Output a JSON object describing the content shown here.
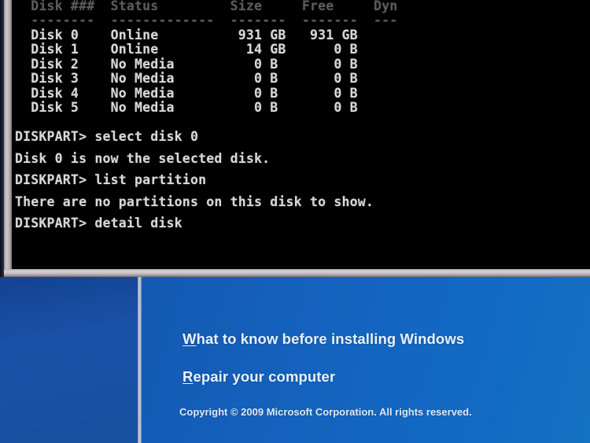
{
  "console": {
    "table": {
      "headers": [
        "Disk ###",
        "Status",
        "Size",
        "Free",
        "Dyn"
      ],
      "header_line": "  Disk ###  Status         Size     Free     Dyn",
      "separator_line": "  --------  -------------  -------  -------  ---",
      "rows": [
        {
          "disk": "Disk 0",
          "status": "Online",
          "size": "931 GB",
          "free": "931 GB"
        },
        {
          "disk": "Disk 1",
          "status": "Online",
          "size": "14 GB",
          "free": "0 B"
        },
        {
          "disk": "Disk 2",
          "status": "No Media",
          "size": "0 B",
          "free": "0 B"
        },
        {
          "disk": "Disk 3",
          "status": "No Media",
          "size": "0 B",
          "free": "0 B"
        },
        {
          "disk": "Disk 4",
          "status": "No Media",
          "size": "0 B",
          "free": "0 B"
        },
        {
          "disk": "Disk 5",
          "status": "No Media",
          "size": "0 B",
          "free": "0 B"
        }
      ],
      "rendered_rows": [
        "  Disk 0    Online          931 GB   931 GB",
        "  Disk 1    Online           14 GB      0 B",
        "  Disk 2    No Media          0 B       0 B",
        "  Disk 3    No Media          0 B       0 B",
        "  Disk 4    No Media          0 B       0 B",
        "  Disk 5    No Media          0 B       0 B"
      ]
    },
    "prompt": "DISKPART>",
    "transcript": [
      "DISKPART> select disk 0",
      "Disk 0 is now the selected disk.",
      "DISKPART> list partition",
      "There are no partitions on this disk to show.",
      "DISKPART> detail disk"
    ],
    "commands": [
      "select disk 0",
      "list partition",
      "detail disk"
    ],
    "messages": [
      "Disk 0 is now the selected disk.",
      "There are no partitions on this disk to show."
    ],
    "colors": {
      "background": "#000000",
      "text": "#d8d8d8",
      "frame": "#cdc9cc"
    }
  },
  "setup": {
    "links": [
      {
        "accel": "W",
        "rest": "hat to know before installing Windows"
      },
      {
        "accel": "R",
        "rest": "epair your computer"
      }
    ],
    "copyright": "Copyright © 2009 Microsoft Corporation. All rights reserved.",
    "colors": {
      "left_pane": "#1a52a8",
      "right_pane": "#1463be",
      "divider": "#c3ccdb",
      "link_text": "#eaf1fb"
    }
  }
}
